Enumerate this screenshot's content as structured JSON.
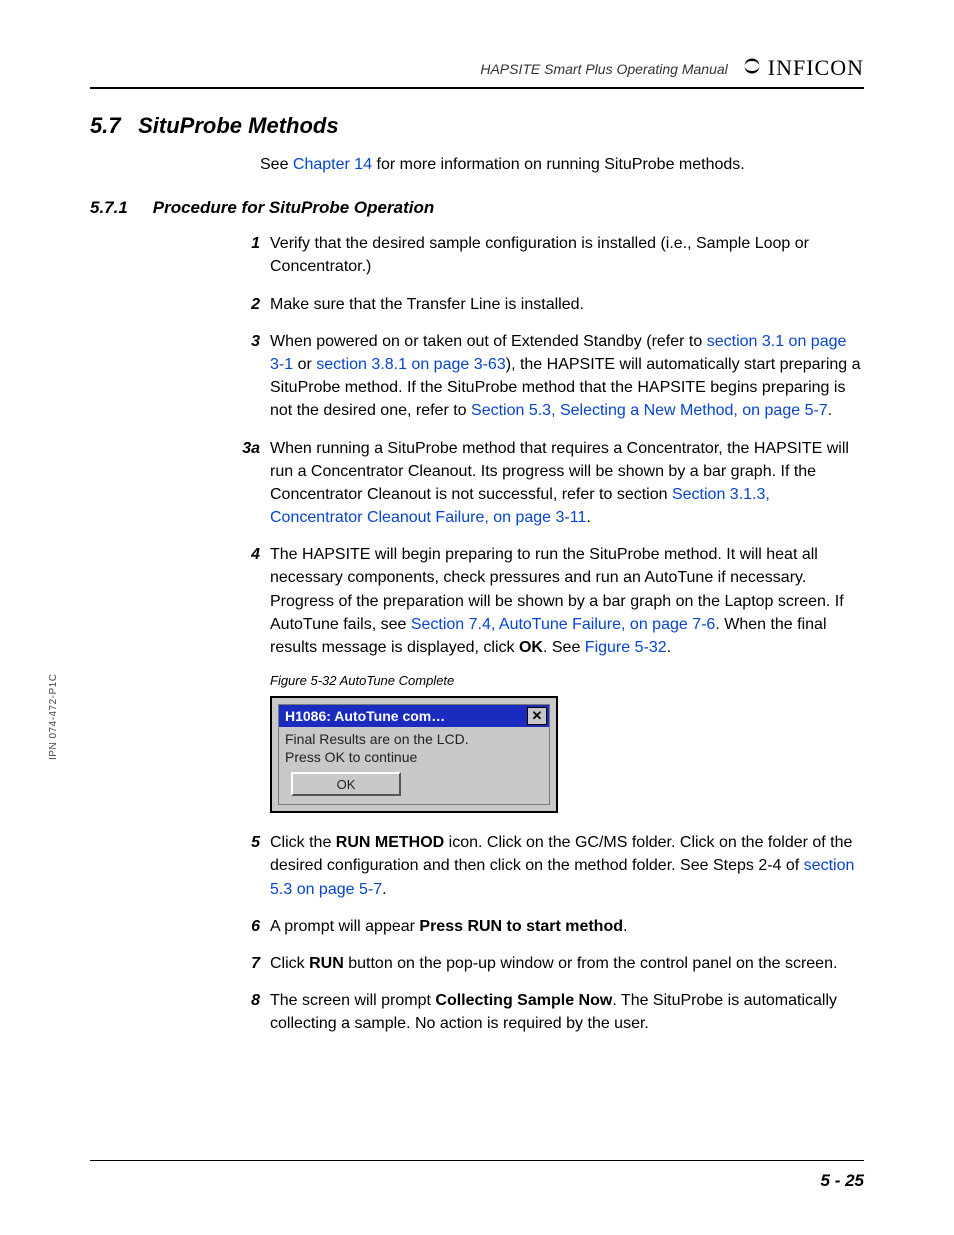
{
  "header": {
    "manual_title": "HAPSITE Smart Plus Operating Manual",
    "brand": "INFICON"
  },
  "section": {
    "number": "5.7",
    "title": "SituProbe Methods",
    "intro_pre": "See ",
    "intro_link": "Chapter 14",
    "intro_post": " for more information on running SituProbe methods."
  },
  "subsection": {
    "number": "5.7.1",
    "title": "Procedure for SituProbe Operation"
  },
  "steps": {
    "s1": {
      "n": "1",
      "text": "Verify that the desired sample configuration is installed (i.e., Sample Loop or Concentrator.)"
    },
    "s2": {
      "n": "2",
      "text": "Make sure that the Transfer Line is installed."
    },
    "s3": {
      "n": "3",
      "a": "When powered on or taken out of Extended Standby (refer to ",
      "la": "section 3.1 on page 3-1",
      "b": " or ",
      "lb": "section 3.8.1 on page 3-63",
      "c": "), the HAPSITE will automatically start preparing a SituProbe method. If the SituProbe method that the HAPSITE begins preparing is not the desired one, refer to ",
      "lc": "Section 5.3, Selecting a New Method, on page 5-7",
      "d": "."
    },
    "s3a": {
      "n": "3a",
      "a": "When running a SituProbe method that requires a Concentrator, the HAPSITE will run a Concentrator Cleanout. Its progress will be shown by a bar graph. If the Concentrator Cleanout is not successful, refer to section ",
      "la": "Section 3.1.3, Concentrator Cleanout Failure, on page 3-11",
      "b": "."
    },
    "s4": {
      "n": "4",
      "a": "The HAPSITE will begin preparing to run the SituProbe method. It will heat all necessary components, check pressures and run an AutoTune if necessary. Progress of the preparation will be shown by a bar graph on the Laptop screen. If AutoTune fails, see ",
      "la": "Section 7.4, AutoTune Failure, on page 7-6",
      "b": ". When the final results message is displayed, click ",
      "bold": "OK",
      "c": ". See ",
      "lb": "Figure 5-32",
      "d": "."
    },
    "s5": {
      "n": "5",
      "a": "Click the ",
      "bold": "RUN METHOD",
      "b": " icon. Click on the GC/MS folder. Click on the folder of the desired configuration and then click on the method folder. See Steps 2-4 of ",
      "la": "section 5.3 on page 5-7",
      "c": "."
    },
    "s6": {
      "n": "6",
      "a": "A prompt will appear ",
      "bold": "Press RUN to start method",
      "b": "."
    },
    "s7": {
      "n": "7",
      "a": "Click ",
      "bold": "RUN",
      "b": " button on the pop-up window or from the control panel on the screen."
    },
    "s8": {
      "n": "8",
      "a": "The screen will prompt ",
      "bold": "Collecting Sample Now",
      "b": ". The SituProbe is automatically collecting a sample. No action is required by the user."
    }
  },
  "figure": {
    "caption": "Figure 5-32  AutoTune Complete",
    "dialog_title": "H1086: AutoTune com…",
    "body_line1": "Final Results are on the LCD.",
    "body_line2": "Press OK to continue",
    "ok_label": "OK"
  },
  "side_code": "IPN 074-472-P1C",
  "page_number": "5 - 25"
}
